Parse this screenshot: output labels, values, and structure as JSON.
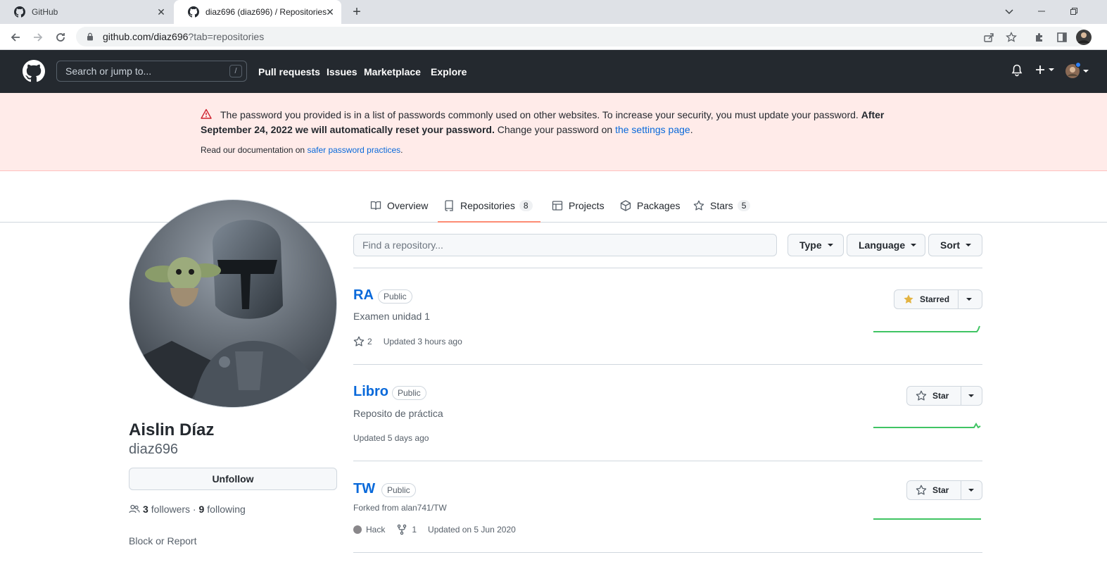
{
  "browser": {
    "tabs": [
      {
        "title": "GitHub"
      },
      {
        "title": "diaz696 (diaz696) / Repositories"
      }
    ],
    "url_host": "github.com/diaz696",
    "url_query": "?tab=repositories"
  },
  "header": {
    "search_placeholder": "Search or jump to...",
    "search_shortcut": "/",
    "nav": [
      "Pull requests",
      "Issues",
      "Marketplace",
      "Explore"
    ]
  },
  "flash": {
    "line_prefix": "The password you provided is in a list of passwords commonly used on other websites. To increase your security, you must update your password. ",
    "bold_after": "After September 24, 2022 we will automatically reset your password.",
    "change_text": " Change your password on ",
    "settings_link": "the settings page",
    "period": ".",
    "doc_prefix": "Read our documentation on ",
    "doc_link": "safer password practices",
    "doc_suffix": "."
  },
  "profile_tabs": [
    {
      "label": "Overview",
      "icon": "book-icon"
    },
    {
      "label": "Repositories",
      "count": "8",
      "icon": "repo-icon",
      "active": true
    },
    {
      "label": "Projects",
      "icon": "table-icon"
    },
    {
      "label": "Packages",
      "icon": "package-icon"
    },
    {
      "label": "Stars",
      "count": "5",
      "icon": "star-icon"
    }
  ],
  "user": {
    "name": "Aislin Díaz",
    "login": "diaz696",
    "unfollow_label": "Unfollow",
    "followers_count": "3",
    "followers_label": "followers",
    "separator": " · ",
    "following_count": "9",
    "following_label": "following",
    "block_label": "Block or Report"
  },
  "filters": {
    "find_placeholder": "Find a repository...",
    "type_label": "Type",
    "language_label": "Language",
    "sort_label": "Sort"
  },
  "repos": [
    {
      "name": "RA",
      "visibility": "Public",
      "description": "Examen unidad 1",
      "stars": "2",
      "updated": "Updated 3 hours ago",
      "star_label": "Starred",
      "starred": true
    },
    {
      "name": "Libro",
      "visibility": "Public",
      "description": "Reposito de práctica",
      "updated": "Updated 5 days ago",
      "star_label": "Star",
      "starred": false
    },
    {
      "name": "TW",
      "visibility": "Public",
      "forked_from": "Forked from alan741/TW",
      "language": "Hack",
      "forks": "1",
      "updated": "Updated on 5 Jun 2020",
      "star_label": "Star",
      "starred": false
    }
  ],
  "colors": {
    "link": "#0969da",
    "header_bg": "#24292f",
    "flash_bg": "#ffebe9",
    "tab_underline": "#fd8c73",
    "sparkline": "#40c463",
    "starred_icon": "#e3b341"
  }
}
